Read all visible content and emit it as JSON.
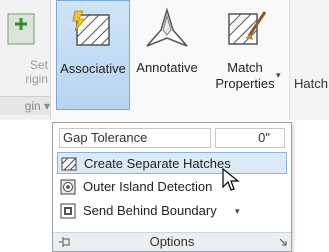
{
  "left_panel": {
    "label_line1": "Set",
    "label_line2": "rigin",
    "dropdown_label": "gin ▾"
  },
  "ribbon": {
    "associative_label": "Associative",
    "annotative_label": "Annotative",
    "match_label_line1": "Match",
    "match_label_line2": "Properties",
    "hatch_label": "Hatch",
    "dropdown_arrow": "▾"
  },
  "options_panel": {
    "gap_tolerance_label": "Gap Tolerance",
    "gap_tolerance_value": "0\"",
    "items": [
      {
        "label": "Create Separate Hatches"
      },
      {
        "label": "Outer Island Detection"
      },
      {
        "label": "Send Behind Boundary"
      }
    ],
    "send_behind_arrow": "▾",
    "footer_title": "Options"
  },
  "colors": {
    "selected_bg": "#cfe4f7",
    "hover_bg": "#dceaf8",
    "border_accent": "#7ea9d6"
  }
}
